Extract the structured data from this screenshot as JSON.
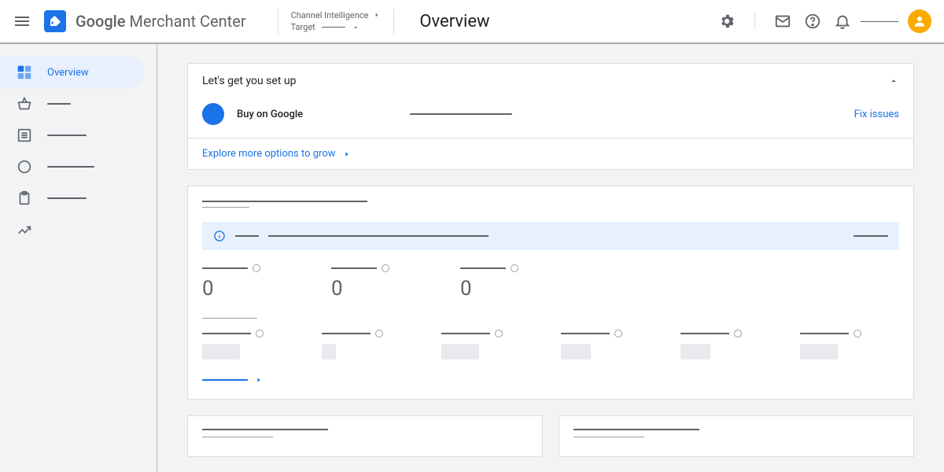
{
  "header": {
    "brand_strong": "Google",
    "brand_rest": " Merchant Center",
    "breadcrumb_top": "Channel Intelligence",
    "breadcrumb_bottom": "Target",
    "page_title": "Overview"
  },
  "sidebar": {
    "items": [
      {
        "label": "Overview",
        "active": true,
        "line_width": 0
      },
      {
        "label": "",
        "active": false,
        "line_width": 30
      },
      {
        "label": "",
        "active": false,
        "line_width": 50
      },
      {
        "label": "",
        "active": false,
        "line_width": 60
      },
      {
        "label": "",
        "active": false,
        "line_width": 50
      },
      {
        "label": "",
        "active": false,
        "line_width": 0
      }
    ]
  },
  "setup_card": {
    "title": "Let's get you set up",
    "program_label": "Buy on Google",
    "fix_link": "Fix issues",
    "footer_link": "Explore more options to grow"
  },
  "metrics_card": {
    "values3": [
      "0",
      "0",
      "0"
    ]
  }
}
